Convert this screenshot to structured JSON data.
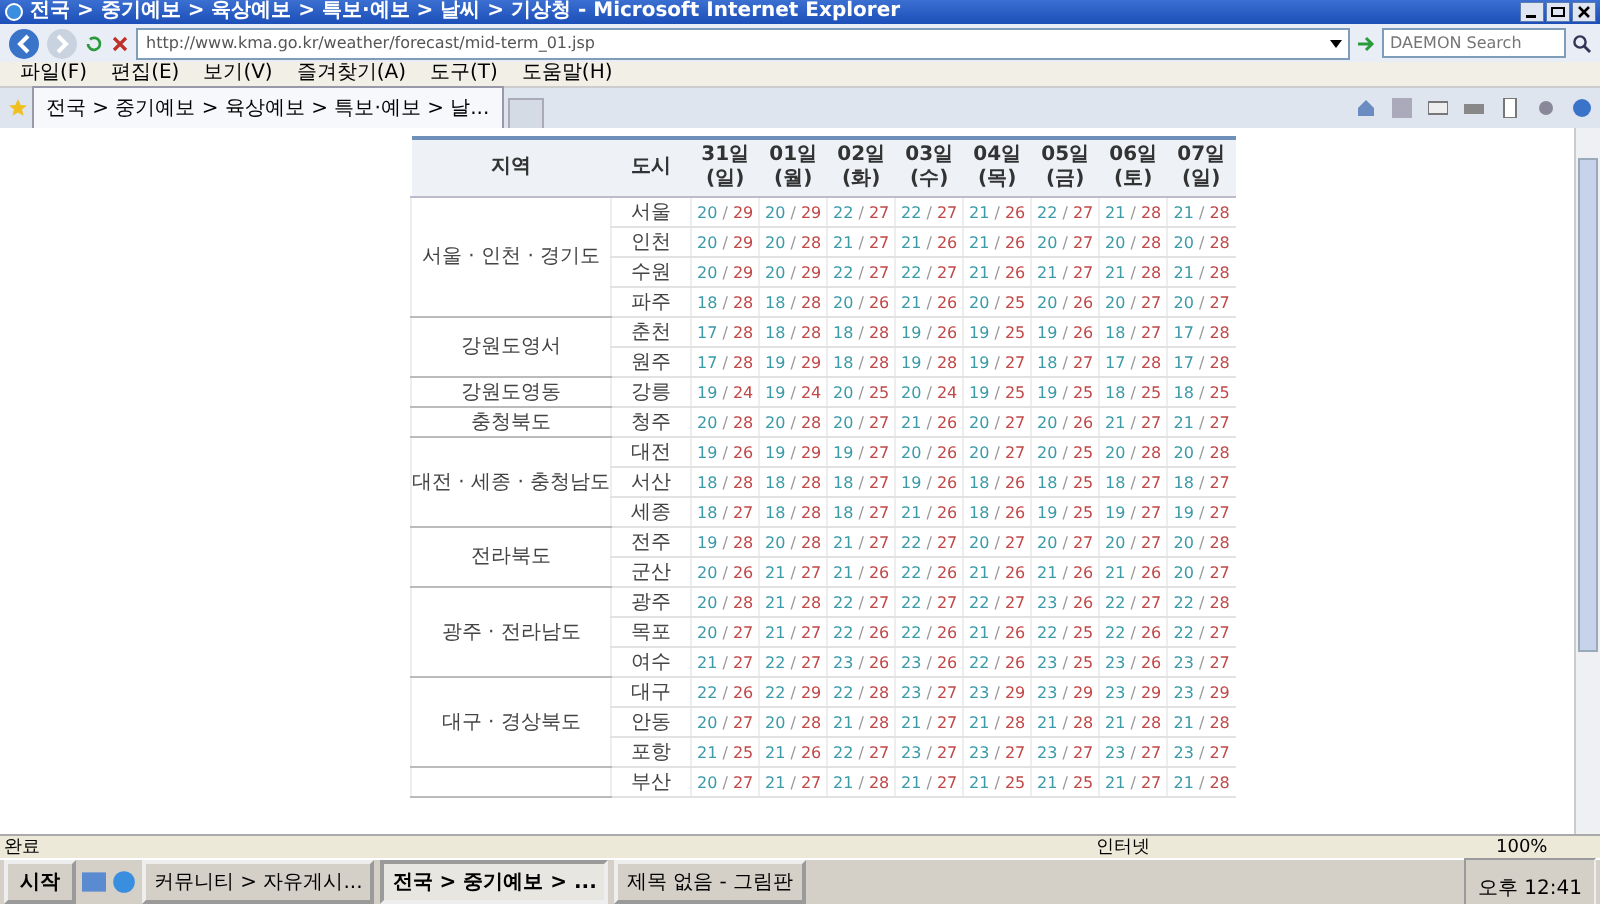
{
  "window": {
    "title": "전국 > 중기예보 > 육상예보 > 특보·예보 > 날씨 > 기상청 - Microsoft Internet Explorer"
  },
  "address_bar": {
    "url": "http://www.kma.go.kr/weather/forecast/mid-term_01.jsp",
    "search_placeholder": "DAEMON Search"
  },
  "menu": [
    "파일(F)",
    "편집(E)",
    "보기(V)",
    "즐겨찾기(A)",
    "도구(T)",
    "도움말(H)"
  ],
  "tabs": [
    {
      "label": "전국 > 중기예보 > 육상예보 > 특보·예보 > 날...",
      "selected": true
    }
  ],
  "table": {
    "columns": [
      "지역",
      "도시"
    ],
    "days": [
      {
        "date": "31일",
        "weekday": "(일)"
      },
      {
        "date": "01일",
        "weekday": "(월)"
      },
      {
        "date": "02일",
        "weekday": "(화)"
      },
      {
        "date": "03일",
        "weekday": "(수)"
      },
      {
        "date": "04일",
        "weekday": "(목)"
      },
      {
        "date": "05일",
        "weekday": "(금)"
      },
      {
        "date": "06일",
        "weekday": "(토)"
      },
      {
        "date": "07일",
        "weekday": "(일)"
      }
    ],
    "regions": [
      {
        "label": "서울 · 인천 · 경기도",
        "cities": [
          {
            "name": "서울",
            "temps": [
              "20 / 29",
              "20 / 29",
              "22 / 27",
              "22 / 27",
              "21 / 26",
              "22 / 27",
              "21 / 28",
              "21 / 28"
            ]
          },
          {
            "name": "인천",
            "temps": [
              "20 / 29",
              "20 / 28",
              "21 / 27",
              "21 / 26",
              "21 / 26",
              "20 / 27",
              "20 / 28",
              "20 / 28"
            ]
          },
          {
            "name": "수원",
            "temps": [
              "20 / 29",
              "20 / 29",
              "22 / 27",
              "22 / 27",
              "21 / 26",
              "21 / 27",
              "21 / 28",
              "21 / 28"
            ]
          },
          {
            "name": "파주",
            "temps": [
              "18 / 28",
              "18 / 28",
              "20 / 26",
              "21 / 26",
              "20 / 25",
              "20 / 26",
              "20 / 27",
              "20 / 27"
            ]
          }
        ]
      },
      {
        "label": "강원도영서",
        "cities": [
          {
            "name": "춘천",
            "temps": [
              "17 / 28",
              "18 / 28",
              "18 / 28",
              "19 / 26",
              "19 / 25",
              "19 / 26",
              "18 / 27",
              "17 / 28"
            ]
          },
          {
            "name": "원주",
            "temps": [
              "17 / 28",
              "19 / 29",
              "18 / 28",
              "19 / 28",
              "19 / 27",
              "18 / 27",
              "17 / 28",
              "17 / 28"
            ]
          }
        ]
      },
      {
        "label": "강원도영동",
        "cities": [
          {
            "name": "강릉",
            "temps": [
              "19 / 24",
              "19 / 24",
              "20 / 25",
              "20 / 24",
              "19 / 25",
              "19 / 25",
              "18 / 25",
              "18 / 25"
            ]
          }
        ]
      },
      {
        "label": "충청북도",
        "cities": [
          {
            "name": "청주",
            "temps": [
              "20 / 28",
              "20 / 28",
              "20 / 27",
              "21 / 26",
              "20 / 27",
              "20 / 26",
              "21 / 27",
              "21 / 27"
            ]
          }
        ]
      },
      {
        "label": "대전 · 세종 · 충청남도",
        "cities": [
          {
            "name": "대전",
            "temps": [
              "19 / 26",
              "19 / 29",
              "19 / 27",
              "20 / 26",
              "20 / 27",
              "20 / 25",
              "20 / 28",
              "20 / 28"
            ]
          },
          {
            "name": "서산",
            "temps": [
              "18 / 28",
              "18 / 28",
              "18 / 27",
              "19 / 26",
              "18 / 26",
              "18 / 25",
              "18 / 27",
              "18 / 27"
            ]
          },
          {
            "name": "세종",
            "temps": [
              "18 / 27",
              "18 / 28",
              "18 / 27",
              "21 / 26",
              "18 / 26",
              "19 / 25",
              "19 / 27",
              "19 / 27"
            ]
          }
        ]
      },
      {
        "label": "전라북도",
        "cities": [
          {
            "name": "전주",
            "temps": [
              "19 / 28",
              "20 / 28",
              "21 / 27",
              "22 / 27",
              "20 / 27",
              "20 / 27",
              "20 / 27",
              "20 / 28"
            ]
          },
          {
            "name": "군산",
            "temps": [
              "20 / 26",
              "21 / 27",
              "21 / 26",
              "22 / 26",
              "21 / 26",
              "21 / 26",
              "21 / 26",
              "20 / 27"
            ]
          }
        ]
      },
      {
        "label": "광주 · 전라남도",
        "cities": [
          {
            "name": "광주",
            "temps": [
              "20 / 28",
              "21 / 28",
              "22 / 27",
              "22 / 27",
              "22 / 27",
              "23 / 26",
              "22 / 27",
              "22 / 28"
            ]
          },
          {
            "name": "목포",
            "temps": [
              "20 / 27",
              "21 / 27",
              "22 / 26",
              "22 / 26",
              "21 / 26",
              "22 / 25",
              "22 / 26",
              "22 / 27"
            ]
          },
          {
            "name": "여수",
            "temps": [
              "21 / 27",
              "22 / 27",
              "23 / 26",
              "23 / 26",
              "22 / 26",
              "23 / 25",
              "23 / 26",
              "23 / 27"
            ]
          }
        ]
      },
      {
        "label": "대구 · 경상북도",
        "cities": [
          {
            "name": "대구",
            "temps": [
              "22 / 26",
              "22 / 29",
              "22 / 28",
              "23 / 27",
              "23 / 29",
              "23 / 29",
              "23 / 29",
              "23 / 29"
            ]
          },
          {
            "name": "안동",
            "temps": [
              "20 / 27",
              "20 / 28",
              "21 / 28",
              "21 / 27",
              "21 / 28",
              "21 / 28",
              "21 / 28",
              "21 / 28"
            ]
          },
          {
            "name": "포항",
            "temps": [
              "21 / 25",
              "21 / 26",
              "22 / 27",
              "23 / 27",
              "23 / 27",
              "23 / 27",
              "23 / 27",
              "23 / 27"
            ]
          }
        ]
      },
      {
        "cities": [
          {
            "name": "부산",
            "temps": [
              "20 / 27",
              "21 / 27",
              "21 / 28",
              "21 / 27",
              "21 / 25",
              "21 / 25",
              "21 / 27",
              "21 / 28"
            ]
          }
        ]
      }
    ]
  },
  "status_bar": {
    "text": "완료",
    "zone": "인터넷",
    "zoom": "100%"
  },
  "taskbar": {
    "start": "시작",
    "tasks": [
      {
        "label": "커뮤니티 > 자유게시...",
        "selected": false
      },
      {
        "label": "전국 > 중기예보 > ...",
        "selected": true
      },
      {
        "label": "제목 없음 - 그림판",
        "selected": false
      }
    ],
    "clock": "오후 12:41"
  }
}
